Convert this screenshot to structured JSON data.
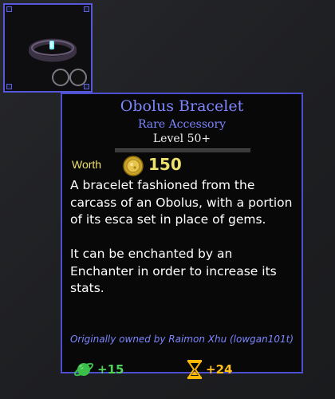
{
  "item": {
    "name": "Obolus Bracelet",
    "rarity": "Rare Accessory",
    "level": "Level 50+",
    "worth_label": "Worth",
    "worth_value": "150",
    "description": [
      "A bracelet fashioned from the carcass of an Obolus, with a portion of its esca set in place of gems.",
      "It can be enchanted by an Enchanter in order to increase its stats."
    ],
    "owner": "Originally owned by Raimon Xhu (lowgan101t)",
    "stats": [
      {
        "icon": "planet-icon",
        "value": "+15",
        "color": "#4fd25a"
      },
      {
        "icon": "hourglass-icon",
        "value": "+24",
        "color": "#ffc01a"
      }
    ]
  },
  "colors": {
    "accent": "#4b4fd0",
    "title": "#7d85ff",
    "worth": "#ece06e"
  }
}
